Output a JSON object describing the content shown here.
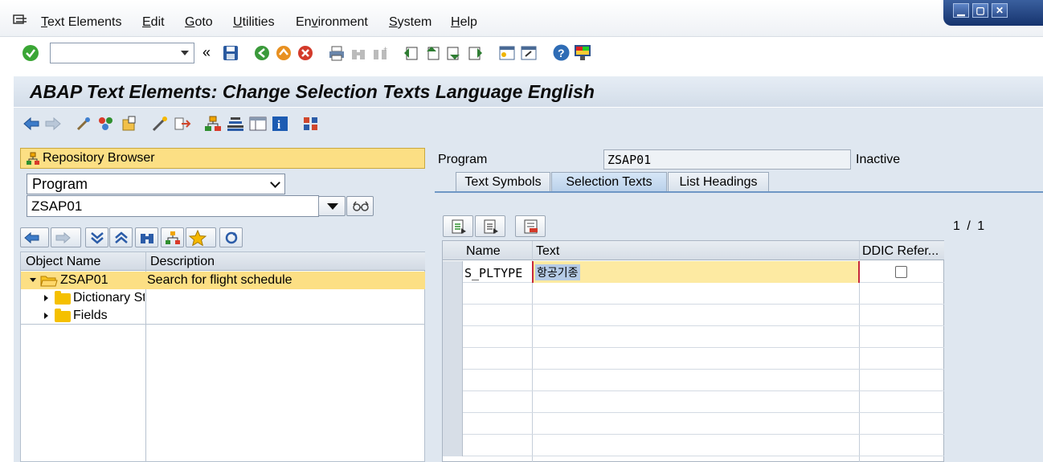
{
  "menu": {
    "items": [
      "Text Elements",
      "Edit",
      "Goto",
      "Utilities",
      "Environment",
      "System",
      "Help"
    ],
    "underline": [
      "T",
      "E",
      "G",
      "U",
      "v",
      "S",
      "H"
    ]
  },
  "window_controls": {
    "minimize": "▁",
    "maximize": "▢",
    "close": "✕"
  },
  "toolbar": {
    "command_field_value": "",
    "back_glyph": "«"
  },
  "title": "ABAP Text Elements: Change Selection Texts Language English",
  "repository": {
    "header": "Repository Browser",
    "object_type": "Program",
    "object_name": "ZSAP01"
  },
  "tree": {
    "columns": [
      "Object Name",
      "Description"
    ],
    "rows": [
      {
        "name": "ZSAP01",
        "description": "Search for flight schedule",
        "expanded": true
      },
      {
        "name": "Dictionary St",
        "description": ""
      },
      {
        "name": "Fields",
        "description": ""
      }
    ]
  },
  "program": {
    "label": "Program",
    "value": "ZSAP01",
    "status": "Inactive"
  },
  "tabs": [
    "Text Symbols",
    "Selection Texts",
    "List Headings"
  ],
  "active_tab": "Selection Texts",
  "pager": "1 / 1",
  "grid": {
    "columns": [
      "Name",
      "Text",
      "DDIC Refer..."
    ],
    "rows": [
      {
        "name": "S_PLTYPE",
        "text": "항공기종",
        "ddic": false
      }
    ]
  },
  "colors": {
    "highlight": "#fcdf84",
    "content_bg": "#dfe7f0",
    "edit_border": "#c6283b"
  }
}
